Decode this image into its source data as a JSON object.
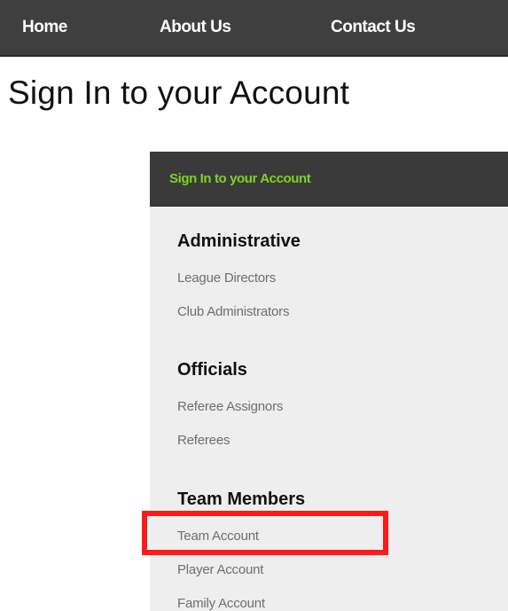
{
  "nav": {
    "home_label": "Home",
    "about_label": "About Us",
    "contact_label": "Contact Us"
  },
  "page": {
    "title": "Sign In to your Account"
  },
  "panel": {
    "header": "Sign In to your Account",
    "sections": [
      {
        "heading": "Administrative",
        "links": [
          "League Directors",
          "Club Administrators"
        ]
      },
      {
        "heading": "Officials",
        "links": [
          "Referee Assignors",
          "Referees"
        ]
      },
      {
        "heading": "Team Members",
        "links": [
          "Team Account",
          "Player Account",
          "Family Account"
        ]
      }
    ]
  },
  "colors": {
    "nav_bg": "#3f3f3f",
    "panel_header_bg": "#3a3a3a",
    "panel_header_text": "#7ed321",
    "panel_bg": "#eeeeee",
    "link_gray": "#6e6e6e",
    "highlight_red": "#ff1a1a"
  }
}
